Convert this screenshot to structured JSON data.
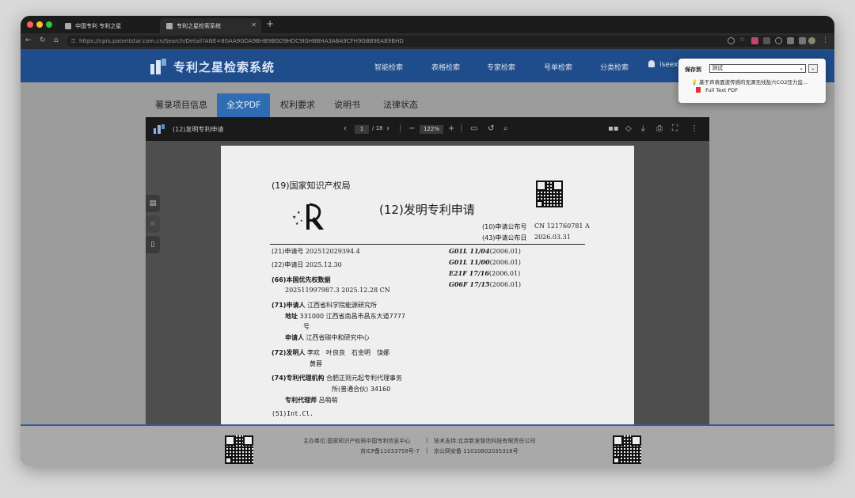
{
  "browser": {
    "tabs": [
      {
        "label": "中国专利 专利之星"
      },
      {
        "label": "专利之星检索系统"
      }
    ],
    "url": "https://cprs.patentstar.com.cn/Search/Detail?ANE=8GAA9GDA9BHB9BGD9HDC9IGH8BHA3ABA9CFH9GBB9EAB9BHD"
  },
  "site": {
    "logo_text": "专利之星检索系统",
    "nav": [
      "智能检索",
      "表格检索",
      "专家检索",
      "号单检索",
      "分类检索"
    ],
    "user": "iseexuh"
  },
  "detail_tabs": [
    {
      "label": "著录项目信息",
      "active": false
    },
    {
      "label": "全文PDF",
      "active": true
    },
    {
      "label": "权利要求",
      "active": false
    },
    {
      "label": "说明书",
      "active": false
    },
    {
      "label": "法律状态",
      "active": false
    }
  ],
  "viewer": {
    "title": "(12)发明专利申请",
    "page_current": "1",
    "page_total": "/ 18",
    "zoom": "122%"
  },
  "document": {
    "office": "(19)国家知识产权局",
    "doc_type": "(12)发明专利申请",
    "pub_no_label": "(10)申请公布号",
    "pub_no": "CN 121760781 A",
    "pub_date_label": "(43)申请公布日",
    "pub_date": "2026.03.31",
    "left_fields": [
      {
        "label": "(21)申请号",
        "value": "202512029394.4"
      },
      {
        "label": "(22)申请日",
        "value": "2025.12.30"
      },
      {
        "label": "(66)本国优先权数据",
        "value": ""
      },
      {
        "label": "",
        "value": "202511997987.3 2025.12.28 CN"
      },
      {
        "label": "(71)申请人",
        "value": "江西省科学院能源研究所"
      },
      {
        "label": "地址",
        "value": "331000 江西省南昌市昌东大道7777"
      },
      {
        "label": "",
        "value": "号"
      },
      {
        "label": "申请人",
        "value": "江西省碳中和研究中心"
      },
      {
        "label": "(72)发明人",
        "value": "李欢　叶良良　石金明　饶娜"
      },
      {
        "label": "",
        "value": "黄蓉"
      },
      {
        "label": "(74)专利代理机构",
        "value": "合肥正则元起专利代理事务"
      },
      {
        "label": "",
        "value": "所(普通合伙) 34160"
      },
      {
        "label": "专利代理师",
        "value": "吕萌萌"
      },
      {
        "label": "(51)Int.Cl.",
        "value": ""
      }
    ],
    "ipc": [
      {
        "code": "G01L 11/04",
        "ver": "(2006.01)"
      },
      {
        "code": "G01L 11/00",
        "ver": "(2006.01)"
      },
      {
        "code": "E21F 17/16",
        "ver": "(2006.01)"
      },
      {
        "code": "G06F 17/15",
        "ver": "(2006.01)"
      }
    ]
  },
  "footer": {
    "line1_left": "主办单位:国家知识产权局中国专利信息中心",
    "line1_right": "技术支持:北京新发智信科技有限责任公司",
    "line2_left": "京ICP备11033758号-7",
    "line2_right": "京公网安备 11010802035318号",
    "sep": "|"
  },
  "popup": {
    "save_label": "保存到",
    "folder": "测试",
    "item_title": "基于声表面波传感的无源无线盐穴CO2压力监...",
    "item_attachment": "Full Text PDF"
  }
}
